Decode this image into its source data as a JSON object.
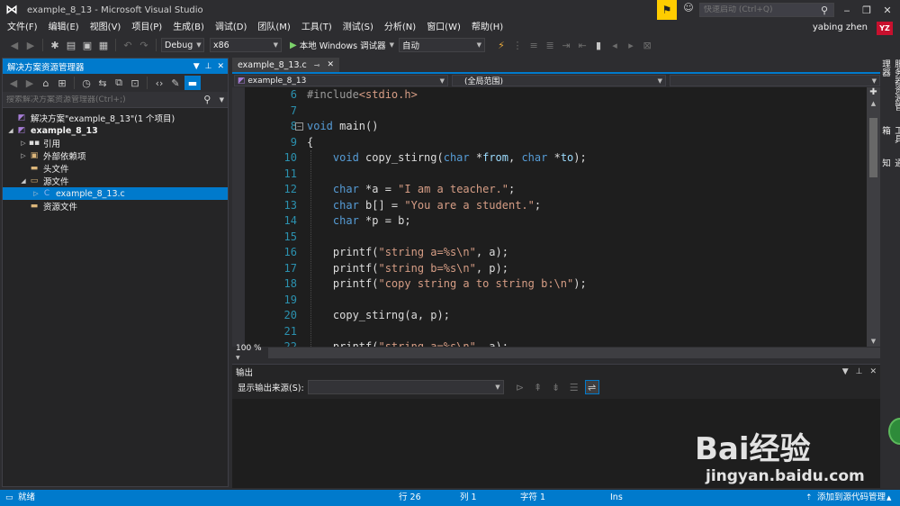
{
  "window": {
    "title": "example_8_13 - Microsoft Visual Studio",
    "quick_launch_placeholder": "快速启动 (Ctrl+Q)",
    "user_name": "yabing zhen",
    "user_initials": "YZ"
  },
  "menu": [
    "文件(F)",
    "编辑(E)",
    "视图(V)",
    "项目(P)",
    "生成(B)",
    "调试(D)",
    "团队(M)",
    "工具(T)",
    "测试(S)",
    "分析(N)",
    "窗口(W)",
    "帮助(H)"
  ],
  "toolbar": {
    "config": "Debug",
    "platform": "x86",
    "run_label": "本地 Windows 调试器",
    "run_mode": "自动"
  },
  "solution_explorer": {
    "title": "解决方案资源管理器",
    "search_placeholder": "搜索解决方案资源管理器(Ctrl+;)",
    "tree": [
      {
        "label": "解决方案\"example_8_13\"(1 个项目)",
        "icon": "solution-icon",
        "level": 0
      },
      {
        "label": "example_8_13",
        "icon": "project-icon",
        "level": 0
      },
      {
        "label": "引用",
        "icon": "references-icon",
        "level": 1
      },
      {
        "label": "外部依赖项",
        "icon": "external-deps-icon",
        "level": 1
      },
      {
        "label": "头文件",
        "icon": "folder-icon",
        "level": 1
      },
      {
        "label": "源文件",
        "icon": "folder-open-icon",
        "level": 1
      },
      {
        "label": "example_8_13.c",
        "icon": "c-file-icon",
        "level": 2
      },
      {
        "label": "资源文件",
        "icon": "folder-icon",
        "level": 1
      }
    ]
  },
  "editor": {
    "tab_label": "example_8_13.c",
    "nav_project": "example_8_13",
    "nav_scope": "(全局范围)",
    "zoom": "100 %",
    "line_numbers": [
      "6",
      "7",
      "8",
      "9",
      "10",
      "11",
      "12",
      "13",
      "14",
      "15",
      "16",
      "17",
      "18",
      "19",
      "20",
      "21",
      "22"
    ]
  },
  "output": {
    "title": "输出",
    "source_label": "显示输出来源(S):"
  },
  "right_rail": [
    "服务器资源管理器",
    "工具箱",
    "通知"
  ],
  "status": {
    "ready": "就绪",
    "line": "行 26",
    "col": "列 1",
    "char": "字符 1",
    "mode": "Ins",
    "source_control": "添加到源代码管理"
  },
  "watermark": {
    "brand": "Bai经验",
    "url": "jingyan.baidu.com"
  },
  "colors": {
    "accent": "#007acc",
    "keyword": "#569cd6",
    "string": "#d69d85",
    "line_number": "#2b91af"
  }
}
